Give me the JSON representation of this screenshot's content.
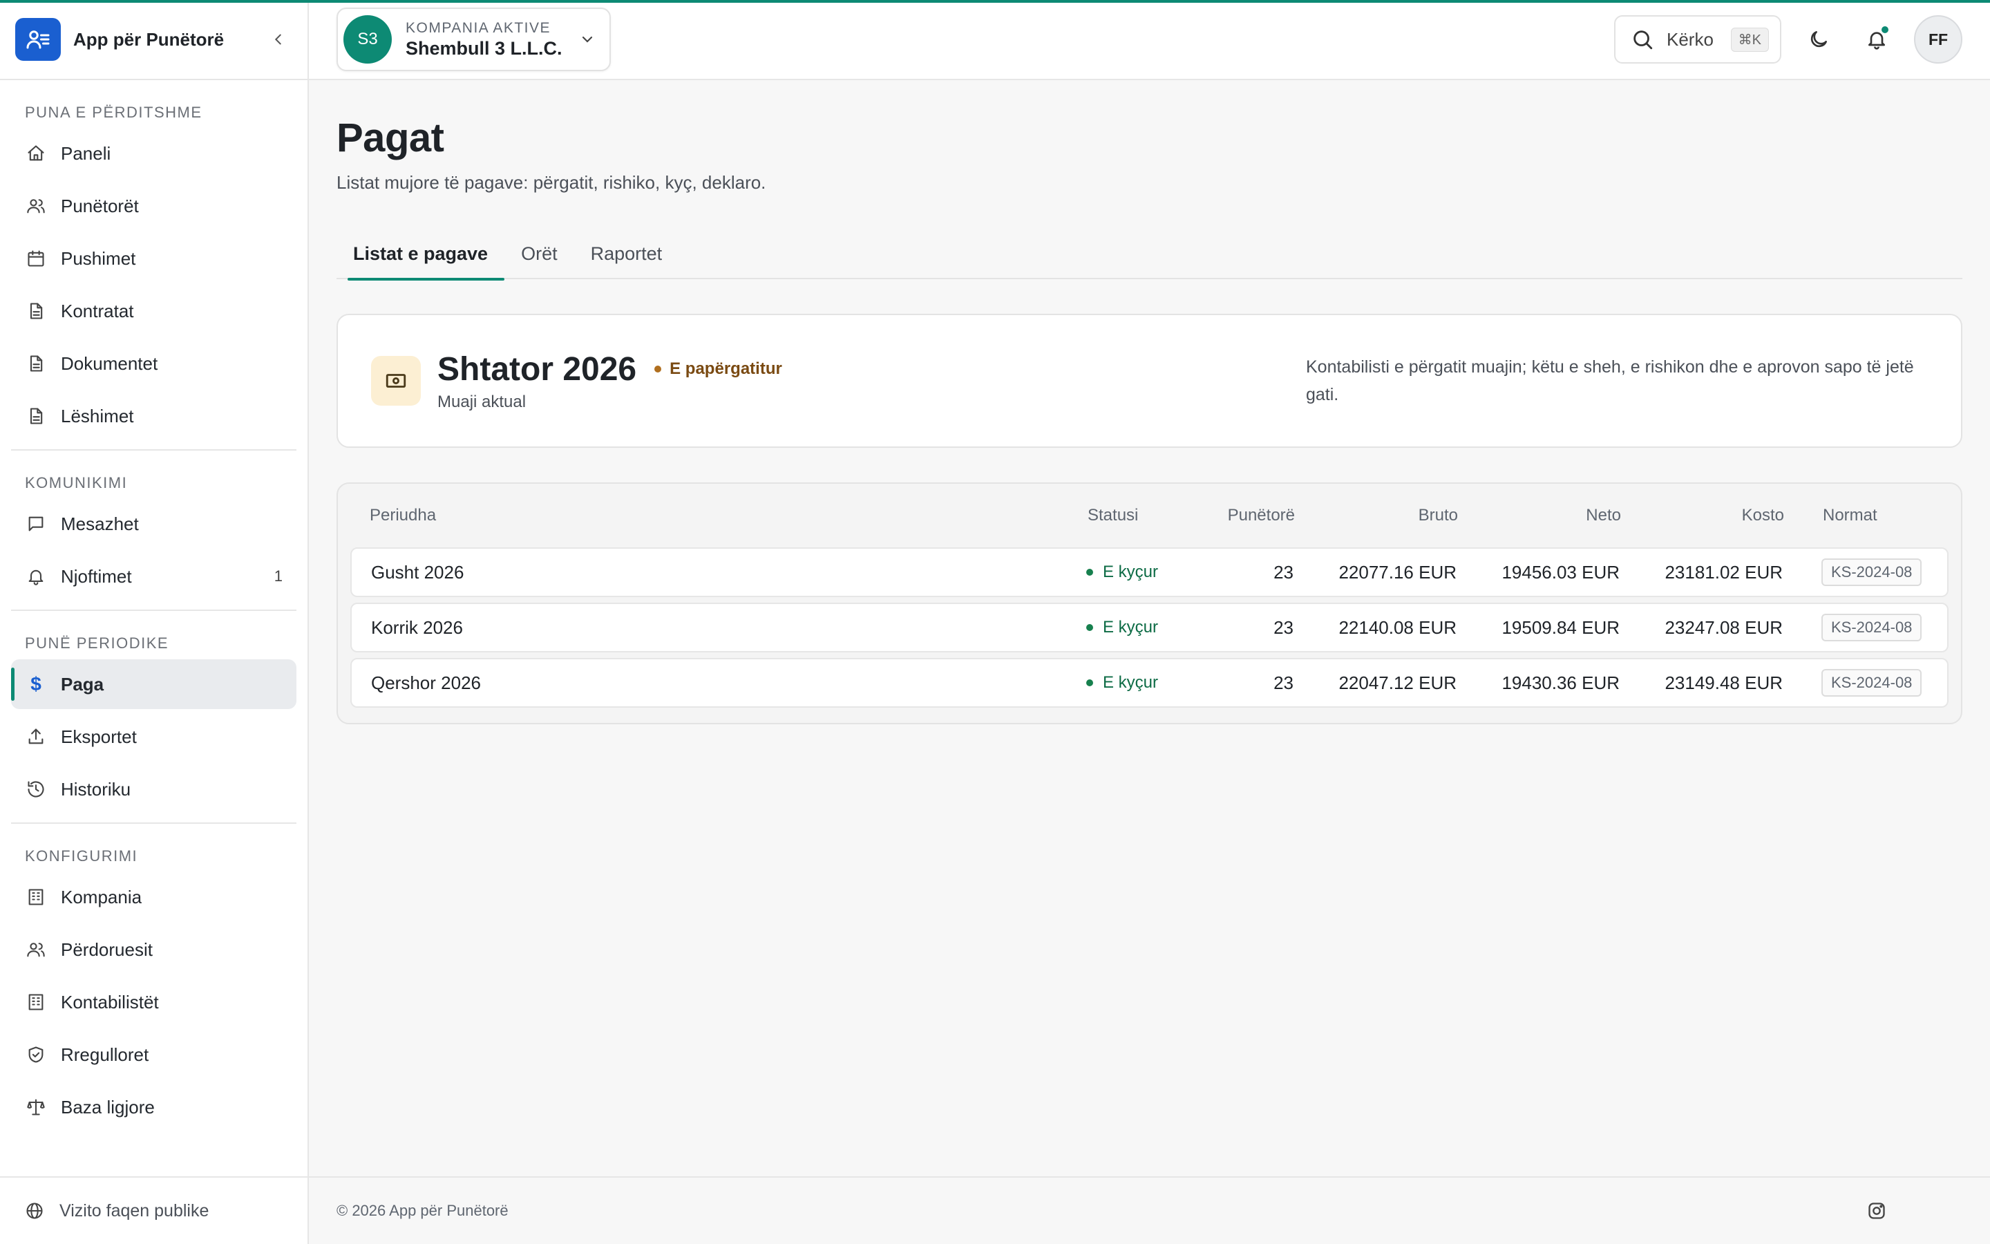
{
  "brand": {
    "name": "App për Punëtorë"
  },
  "sidebar": {
    "sections": [
      {
        "heading": "PUNA E PËRDITSHME",
        "items": [
          {
            "label": "Paneli",
            "icon": "home-icon"
          },
          {
            "label": "Punëtorët",
            "icon": "users-icon"
          },
          {
            "label": "Pushimet",
            "icon": "calendar-icon"
          },
          {
            "label": "Kontratat",
            "icon": "document-icon"
          },
          {
            "label": "Dokumentet",
            "icon": "document-icon"
          },
          {
            "label": "Lëshimet",
            "icon": "document-icon"
          }
        ]
      },
      {
        "heading": "KOMUNIKIMI",
        "items": [
          {
            "label": "Mesazhet",
            "icon": "message-icon"
          },
          {
            "label": "Njoftimet",
            "icon": "bell-icon",
            "count": "1"
          }
        ]
      },
      {
        "heading": "PUNË PERIODIKE",
        "items": [
          {
            "label": "Paga",
            "icon": "dollar-icon",
            "active": true
          },
          {
            "label": "Eksportet",
            "icon": "upload-icon"
          },
          {
            "label": "Historiku",
            "icon": "history-icon"
          }
        ]
      },
      {
        "heading": "KONFIGURIMI",
        "items": [
          {
            "label": "Kompania",
            "icon": "building-icon"
          },
          {
            "label": "Përdoruesit",
            "icon": "users-icon"
          },
          {
            "label": "Kontabilistët",
            "icon": "building-icon"
          },
          {
            "label": "Rregulloret",
            "icon": "shield-icon"
          },
          {
            "label": "Baza ligjore",
            "icon": "scale-icon"
          }
        ]
      }
    ],
    "footer_link": "Vizito faqen publike"
  },
  "header": {
    "company_initials": "S3",
    "company_label": "KOMPANIA AKTIVE",
    "company_name": "Shembull 3 L.L.C.",
    "search_label": "Kërko",
    "search_shortcut": "⌘K",
    "user_initials": "FF"
  },
  "page": {
    "title": "Pagat",
    "subtitle": "Listat mujore të pagave: përgatit, rishiko, kyç, deklaro.",
    "tabs": [
      "Listat e pagave",
      "Orët",
      "Raportet"
    ]
  },
  "current": {
    "month": "Shtator 2026",
    "status": "E papërgatitur",
    "sub": "Muaji aktual",
    "note": "Kontabilisti e përgatit muajin; këtu e sheh, e rishikon dhe e aprovon sapo të jetë gati."
  },
  "table": {
    "columns": [
      "Periudha",
      "Statusi",
      "Punëtorë",
      "Bruto",
      "Neto",
      "Kosto",
      "Normat"
    ],
    "rows": [
      {
        "period": "Gusht 2026",
        "status": "E kyçur",
        "employees": "23",
        "bruto": "22077.16 EUR",
        "neto": "19456.03 EUR",
        "kosto": "23181.02 EUR",
        "norm": "KS-2024-08"
      },
      {
        "period": "Korrik 2026",
        "status": "E kyçur",
        "employees": "23",
        "bruto": "22140.08 EUR",
        "neto": "19509.84 EUR",
        "kosto": "23247.08 EUR",
        "norm": "KS-2024-08"
      },
      {
        "period": "Qershor 2026",
        "status": "E kyçur",
        "employees": "23",
        "bruto": "22047.12 EUR",
        "neto": "19430.36 EUR",
        "kosto": "23149.48 EUR",
        "norm": "KS-2024-08"
      }
    ]
  },
  "footer": {
    "copyright": "© 2026 App për Punëtorë"
  },
  "colors": {
    "accent": "#0d8a74",
    "brand": "#1a5fd0",
    "locked": "#17804e",
    "pending": "#b06f1f"
  }
}
